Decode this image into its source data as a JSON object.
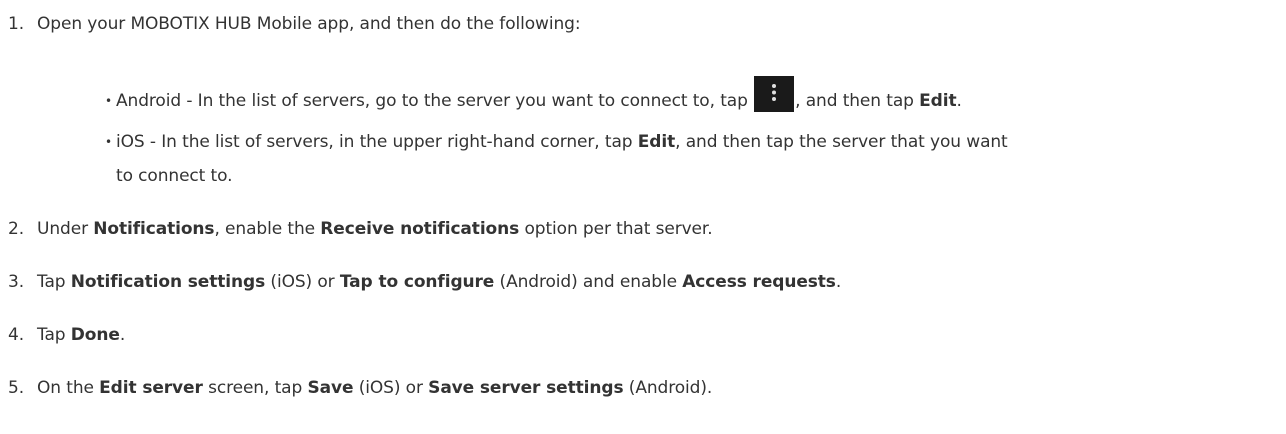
{
  "steps": [
    {
      "num": "1.",
      "text": "Open your MOBOTIX HUB Mobile app, and then do the following:",
      "bullets": [
        {
          "a": "Android - In the list of servers, go to the server you want to connect to, tap ",
          "b": ", and then tap ",
          "c": "Edit",
          "d": ".",
          "icon": "more-vertical-menu-icon"
        },
        {
          "a": "iOS - In the list of servers, in the upper right-hand corner, tap ",
          "b": "Edit",
          "c": ", and then tap the server that you want",
          "d": "to connect to."
        }
      ]
    },
    {
      "num": "2.",
      "a": "Under ",
      "b": "Notifications",
      "c": ", enable the ",
      "d": "Receive notifications",
      "e": " option per that server."
    },
    {
      "num": "3.",
      "a": "Tap ",
      "b": "Notification settings",
      "c": " (iOS) or ",
      "d": "Tap to configure",
      "e": " (Android) and enable ",
      "f": "Access requests",
      "g": "."
    },
    {
      "num": "4.",
      "a": "Tap ",
      "b": "Done",
      "c": "."
    },
    {
      "num": "5.",
      "a": "On the ",
      "b": "Edit server",
      "c": " screen, tap ",
      "d": "Save",
      "e": " (iOS) or ",
      "f": "Save server settings",
      "g": " (Android)."
    }
  ],
  "bullet_char": "•"
}
